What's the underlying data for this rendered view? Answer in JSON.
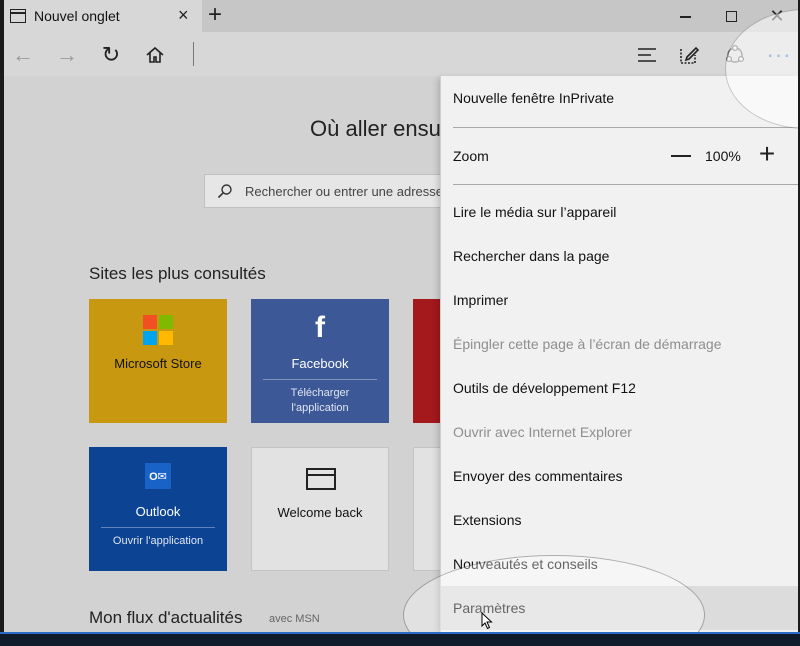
{
  "tab": {
    "title": "Nouvel onglet",
    "close_glyph": "×"
  },
  "new_tab_glyph": "+",
  "window_controls": {
    "close_glyph": "✕"
  },
  "nav": {
    "back_glyph": "←",
    "forward_glyph": "→",
    "refresh_glyph": "↻",
    "more_glyph": "···"
  },
  "page": {
    "heading": "Où aller ensu",
    "search_placeholder": "Rechercher ou entrer une adresse",
    "sites_title": "Sites les plus consultés",
    "tiles": [
      {
        "name": "Microsoft Store",
        "sub": ""
      },
      {
        "name": "Facebook",
        "sub": "Télécharger l'application"
      },
      {
        "name": "Outlook",
        "sub": "Ouvrir l'application"
      },
      {
        "name": "Welcome back",
        "sub": ""
      }
    ],
    "feed_title": "Mon flux d'actualités",
    "feed_sub": "avec MSN"
  },
  "menu": {
    "inprivate": "Nouvelle fenêtre InPrivate",
    "zoom_label": "Zoom",
    "zoom_value": "100%",
    "zoom_plus_glyph": "+",
    "items": [
      {
        "label": "Lire le média sur l’appareil",
        "enabled": true
      },
      {
        "label": "Rechercher dans la page",
        "enabled": true
      },
      {
        "label": "Imprimer",
        "enabled": true
      },
      {
        "label": "Épingler cette page à l’écran de démarrage",
        "enabled": false
      },
      {
        "label": "Outils de développement F12",
        "enabled": true
      },
      {
        "label": "Ouvrir avec Internet Explorer",
        "enabled": false
      },
      {
        "label": "Envoyer des commentaires",
        "enabled": true
      },
      {
        "label": "Extensions",
        "enabled": true
      },
      {
        "label": "Nouveautés et conseils",
        "enabled": true
      },
      {
        "label": "Paramètres",
        "enabled": true
      }
    ]
  },
  "colors": {
    "accent": "#1d64c8",
    "store_tile": "#c89910",
    "facebook_tile": "#3c5896",
    "outlook_tile": "#0c4393",
    "red_tile": "#a3191c",
    "ms_red": "#f25022",
    "ms_green": "#7fba00",
    "ms_blue": "#00a4ef",
    "ms_yellow": "#ffb900"
  },
  "icons": {
    "tab": "new-tab-page-icon",
    "back": "arrow-left-icon",
    "forward": "arrow-right-icon",
    "refresh": "refresh-icon",
    "home": "home-icon",
    "hub": "hub-icon",
    "notes": "web-note-icon",
    "share": "share-icon",
    "more": "more-icon",
    "search": "search-icon"
  }
}
